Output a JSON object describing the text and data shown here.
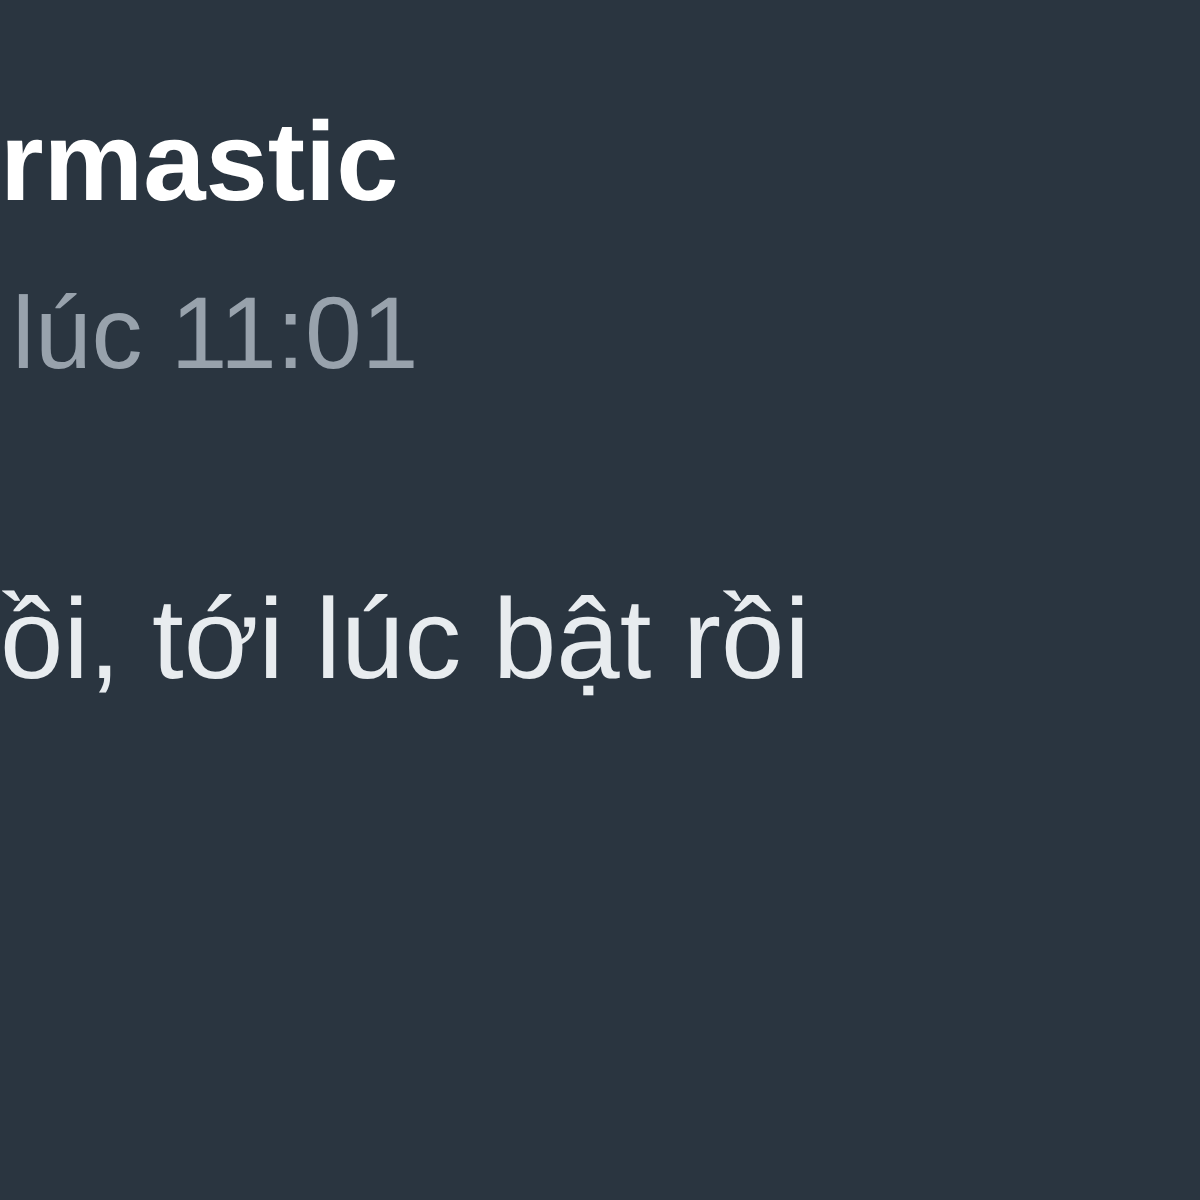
{
  "message": {
    "author": "rmastic",
    "timestamp": "lúc 11:01",
    "text": "ồi, tới lúc bật rồi"
  }
}
